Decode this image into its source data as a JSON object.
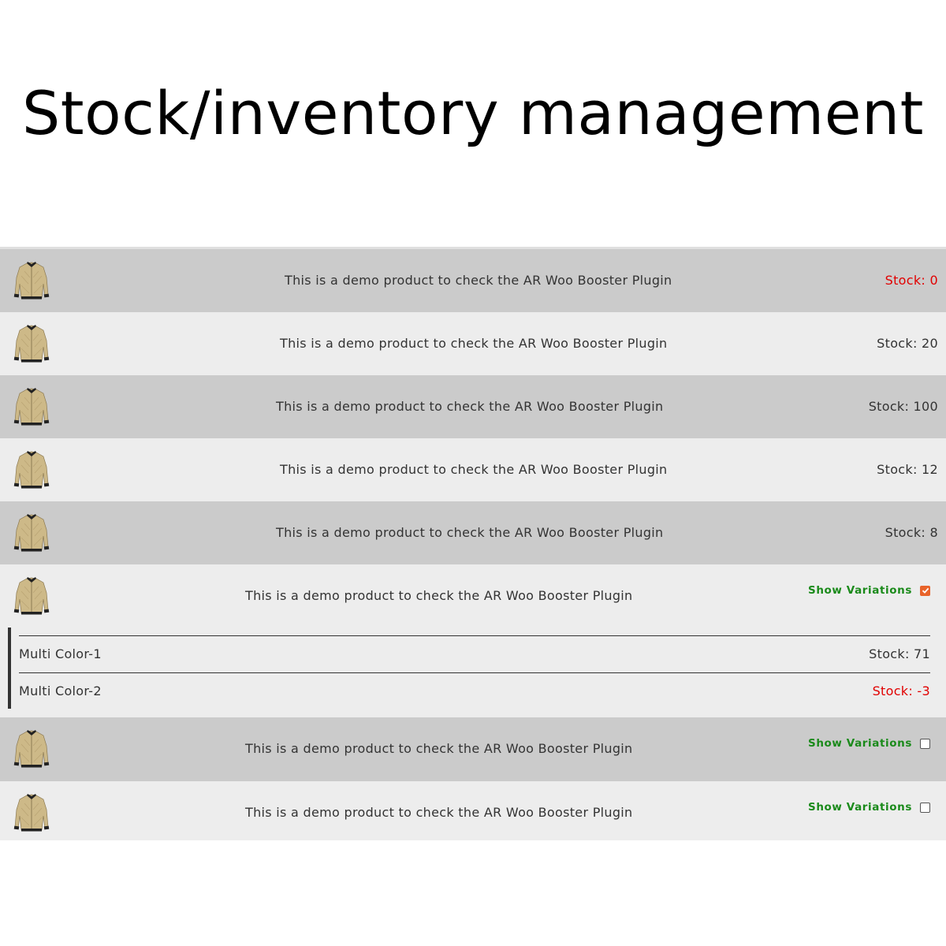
{
  "page": {
    "title": "Stock/inventory management"
  },
  "products": [
    {
      "title": "This is a demo product to check the AR Woo Booster Plugin",
      "stock": "Stock: 0",
      "stock_color": "#e10000",
      "thumbnail_icon": "jacket-icon"
    },
    {
      "title": "This is a demo product to check the AR Woo Booster Plugin",
      "stock": "Stock: 20",
      "stock_color": "#333333",
      "thumbnail_icon": "jacket-icon"
    },
    {
      "title": "This is a demo product to check the AR Woo Booster Plugin",
      "stock": "Stock: 100",
      "stock_color": "#333333",
      "thumbnail_icon": "jacket-icon"
    },
    {
      "title": "This is a demo product to check the AR Woo Booster Plugin",
      "stock": "Stock: 12",
      "stock_color": "#333333",
      "thumbnail_icon": "jacket-icon"
    },
    {
      "title": "This is a demo product to check the AR Woo Booster Plugin",
      "stock": "Stock: 8",
      "stock_color": "#333333",
      "thumbnail_icon": "jacket-icon"
    }
  ],
  "variable_products": [
    {
      "title": "This is a demo product to check the AR Woo Booster Plugin",
      "toggle_label": "Show Variations",
      "checked": true,
      "thumbnail_icon": "jacket-icon",
      "variations": [
        {
          "name": "Multi Color-1",
          "stock": "Stock: 71",
          "stock_color": "#333333"
        },
        {
          "name": "Multi Color-2",
          "stock": "Stock: -3",
          "stock_color": "#e10000"
        }
      ]
    },
    {
      "title": "This is a demo product to check the AR Woo Booster Plugin",
      "toggle_label": "Show Variations",
      "checked": false,
      "thumbnail_icon": "jacket-icon"
    },
    {
      "title": "This is a demo product to check the AR Woo Booster Plugin",
      "toggle_label": "Show Variations",
      "checked": false,
      "thumbnail_icon": "jacket-icon"
    }
  ],
  "colors": {
    "row_dark": "#cbcbcb",
    "row_light": "#ededed",
    "stock_negative": "#e10000",
    "toggle_label": "#1a8a1a",
    "checkbox_checked": "#e8632a"
  }
}
